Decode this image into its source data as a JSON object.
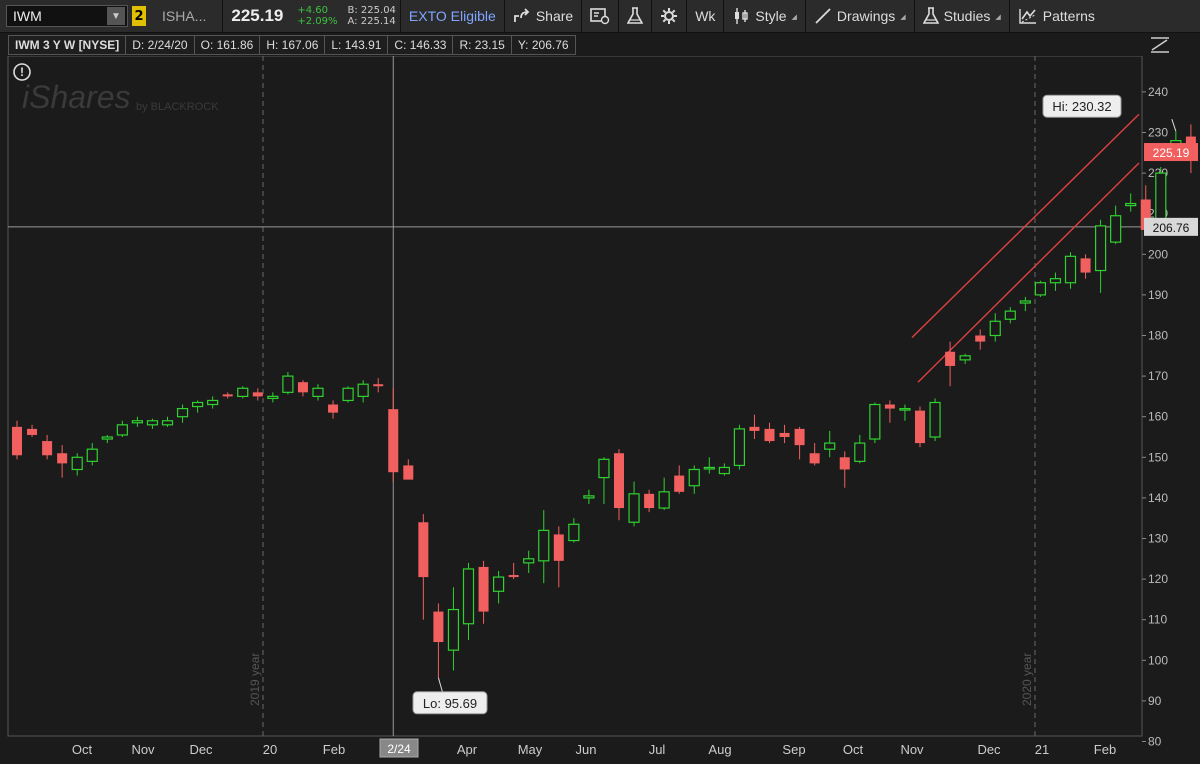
{
  "toolbar": {
    "symbol": "IWM",
    "link_badge": "2",
    "description": "ISHA...",
    "last_price": "225.19",
    "net_change": "+4.60",
    "pct_change": "+2.09%",
    "bid": "B: 225.04",
    "ask": "A: 225.14",
    "exto": "EXTO Eligible",
    "share": "Share",
    "aggregation": "Wk",
    "style": "Style",
    "drawings": "Drawings",
    "studies": "Studies",
    "patterns": "Patterns"
  },
  "infobar": {
    "symbol": "IWM 3 Y W [NYSE]",
    "date": "D: 2/24/20",
    "open": "O: 161.86",
    "high": "H: 167.06",
    "low": "L: 143.91",
    "close": "C: 146.33",
    "range": "R: 23.15",
    "y": "Y: 206.76"
  },
  "chart_data": {
    "type": "candlestick",
    "title": "",
    "xlabel": "",
    "ylabel": "",
    "ylim": [
      80,
      245
    ],
    "y_ticks": [
      80,
      90,
      100,
      110,
      120,
      130,
      140,
      150,
      160,
      170,
      180,
      190,
      200,
      210,
      220,
      230,
      240
    ],
    "x_ticks": [
      "Oct",
      "Nov",
      "Dec",
      "20",
      "Feb",
      "2/24",
      "Apr",
      "May",
      "Jun",
      "Jul",
      "Aug",
      "Sep",
      "Oct",
      "Nov",
      "Dec",
      "21",
      "Feb"
    ],
    "year_markers": [
      "2019 year",
      "2020 year"
    ],
    "watermark": "iShares by BLACKROCK",
    "colors": {
      "up": "#2fd22f",
      "down": "#f25f5f",
      "price_label": "#f25f5f",
      "background": "#1b1b1b",
      "grid": "#4a4a4a"
    },
    "current_price_label": "225.19",
    "crosshair_price_label": "206.76",
    "crosshair_date_label": "2/24",
    "high_label": "Hi: 230.32",
    "low_label": "Lo: 95.69",
    "candles": [
      [
        157.5,
        159.0,
        149.5,
        150.5
      ],
      [
        157.0,
        158.0,
        155.0,
        155.5
      ],
      [
        154.0,
        155.5,
        149.5,
        150.5
      ],
      [
        151.0,
        153.0,
        145.0,
        148.5
      ],
      [
        147.0,
        151.0,
        145.5,
        150.0
      ],
      [
        149.0,
        153.5,
        148.0,
        152.0
      ],
      [
        154.5,
        155.5,
        153.5,
        155.0
      ],
      [
        155.5,
        159.0,
        155.0,
        158.0
      ],
      [
        158.5,
        160.0,
        157.5,
        159.0
      ],
      [
        158.0,
        159.5,
        157.0,
        159.0
      ],
      [
        158.0,
        160.0,
        157.5,
        159.0
      ],
      [
        160.0,
        163.0,
        158.5,
        162.0
      ],
      [
        162.5,
        164.0,
        161.0,
        163.5
      ],
      [
        163.0,
        165.0,
        162.0,
        164.0
      ],
      [
        165.5,
        166.0,
        164.5,
        165.0
      ],
      [
        165.0,
        167.5,
        164.5,
        167.0
      ],
      [
        166.0,
        167.0,
        164.0,
        165.0
      ],
      [
        164.5,
        166.0,
        163.5,
        165.0
      ],
      [
        166.0,
        171.0,
        165.5,
        170.0
      ],
      [
        168.5,
        169.0,
        165.0,
        166.0
      ],
      [
        165.0,
        168.0,
        164.0,
        167.0
      ],
      [
        163.0,
        164.0,
        159.5,
        161.0
      ],
      [
        164.0,
        167.5,
        163.5,
        167.0
      ],
      [
        165.0,
        169.0,
        163.5,
        168.0
      ],
      [
        168.0,
        169.5,
        166.0,
        167.5
      ],
      [
        161.86,
        167.06,
        143.91,
        146.33
      ],
      [
        148.0,
        149.5,
        145.5,
        144.5
      ],
      [
        134.0,
        136.0,
        110.0,
        120.5
      ],
      [
        112.0,
        114.0,
        95.69,
        104.5
      ],
      [
        102.5,
        118.0,
        97.5,
        112.5
      ],
      [
        109.0,
        124.0,
        105.0,
        122.5
      ],
      [
        123.0,
        124.5,
        109.0,
        112.0
      ],
      [
        117.0,
        122.0,
        114.0,
        120.5
      ],
      [
        121.0,
        124.0,
        120.0,
        120.5
      ],
      [
        124.0,
        127.0,
        121.5,
        125.0
      ],
      [
        124.5,
        137.0,
        119.0,
        132.0
      ],
      [
        131.0,
        133.0,
        118.0,
        124.5
      ],
      [
        129.5,
        135.0,
        129.0,
        133.5
      ],
      [
        140.0,
        142.0,
        138.5,
        140.5
      ],
      [
        145.0,
        150.0,
        138.5,
        149.5
      ],
      [
        151.0,
        152.0,
        134.5,
        137.5
      ],
      [
        134.0,
        144.0,
        133.0,
        141.0
      ],
      [
        141.0,
        142.0,
        136.5,
        137.5
      ],
      [
        137.5,
        145.0,
        137.0,
        141.5
      ],
      [
        145.5,
        148.0,
        141.0,
        141.5
      ],
      [
        143.0,
        148.0,
        141.0,
        147.0
      ],
      [
        147.5,
        150.0,
        146.0,
        147.5
      ],
      [
        146.0,
        148.5,
        145.5,
        147.5
      ],
      [
        148.0,
        158.0,
        147.0,
        157.0
      ],
      [
        157.5,
        160.5,
        154.5,
        156.5
      ],
      [
        157.0,
        158.5,
        153.5,
        154.0
      ],
      [
        156.0,
        158.0,
        153.5,
        155.0
      ],
      [
        157.0,
        157.5,
        149.5,
        153.0
      ],
      [
        151.0,
        153.5,
        148.0,
        148.5
      ],
      [
        152.0,
        156.5,
        150.0,
        153.5
      ],
      [
        150.0,
        151.5,
        142.5,
        147.0
      ],
      [
        149.0,
        155.5,
        148.5,
        153.5
      ],
      [
        154.5,
        163.5,
        153.5,
        163.0
      ],
      [
        163.0,
        164.0,
        158.5,
        162.0
      ],
      [
        162.0,
        163.0,
        159.0,
        162.0
      ],
      [
        161.5,
        162.5,
        152.5,
        153.5
      ],
      [
        155.0,
        164.5,
        154.0,
        163.5
      ],
      [
        176.0,
        178.5,
        167.5,
        172.5
      ],
      [
        174.0,
        175.5,
        173.0,
        175.0
      ],
      [
        180.0,
        181.5,
        176.5,
        178.5
      ],
      [
        180.0,
        185.5,
        178.5,
        183.5
      ],
      [
        184.0,
        187.0,
        183.0,
        186.0
      ],
      [
        188.0,
        189.5,
        186.0,
        188.5
      ],
      [
        190.0,
        193.5,
        189.5,
        193.0
      ],
      [
        193.0,
        195.5,
        191.0,
        194.0
      ],
      [
        193.0,
        200.5,
        191.5,
        199.5
      ],
      [
        199.0,
        200.0,
        194.0,
        195.5
      ],
      [
        196.0,
        208.5,
        190.5,
        207.0
      ],
      [
        203.0,
        212.0,
        202.5,
        209.5
      ],
      [
        212.0,
        215.0,
        210.5,
        212.5
      ],
      [
        213.5,
        217.0,
        205.5,
        206.0
      ],
      [
        208.0,
        221.5,
        206.5,
        220.0
      ],
      [
        225.0,
        230.32,
        224.5,
        228.0
      ],
      [
        229.0,
        232.0,
        220.0,
        225.19
      ]
    ]
  }
}
